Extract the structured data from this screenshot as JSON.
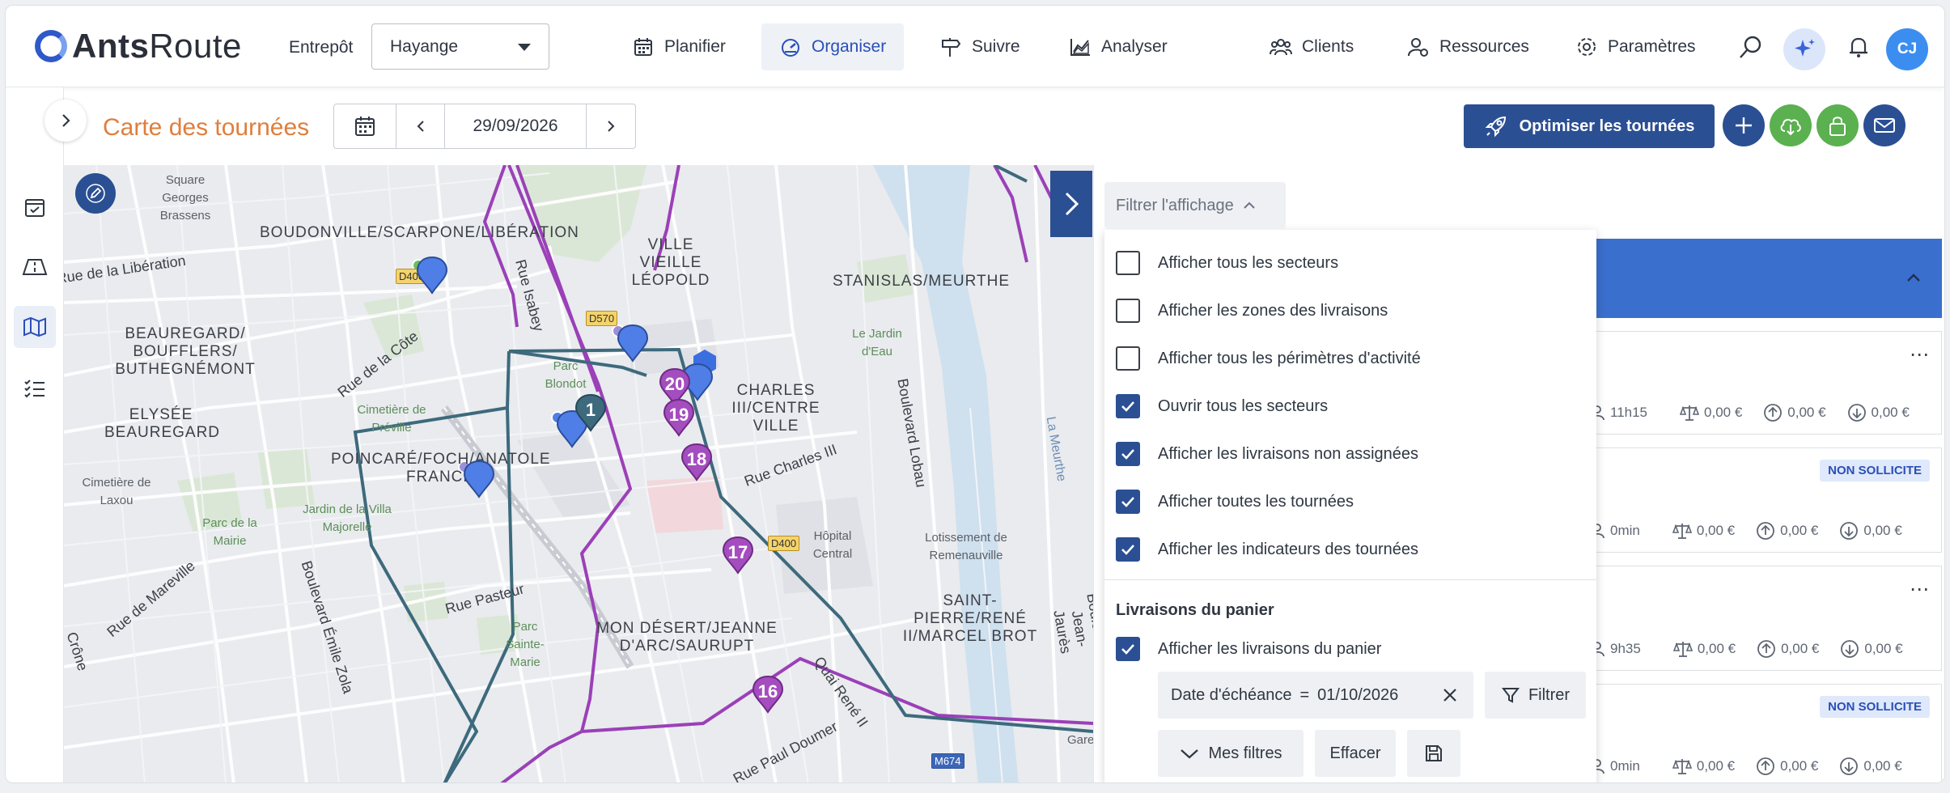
{
  "brand": {
    "name_bold": "Ants",
    "name_regular": "Route"
  },
  "warehouse": {
    "label": "Entrepôt",
    "value": "Hayange"
  },
  "nav": {
    "items": [
      {
        "label": "Planifier",
        "icon": "calendar-icon"
      },
      {
        "label": "Organiser",
        "icon": "dashboard-icon",
        "active": true
      },
      {
        "label": "Suivre",
        "icon": "signpost-icon"
      },
      {
        "label": "Analyser",
        "icon": "chart-icon"
      },
      {
        "label": "Clients",
        "icon": "users-icon"
      },
      {
        "label": "Ressources",
        "icon": "user-gear-icon"
      },
      {
        "label": "Paramètres",
        "icon": "gear-icon"
      }
    ],
    "avatar_initials": "CJ"
  },
  "page": {
    "title": "Carte des tournées",
    "date": "29/09/2026",
    "optimize_label": "Optimiser les tournées"
  },
  "map": {
    "districts": [
      "BOUDONVILLE/SCARPONE/LIBÉRATION",
      "VILLE VIEILLE LÉOPOLD",
      "STANISLAS/MEURTHE",
      "BEAUREGARD/ BOUFFLERS/ BUTHEGNÉMONT",
      "ELYSÉE BEAUREGARD",
      "CHARLES III/CENTRE VILLE",
      "POINCARÉ/FOCH/ANATOLE FRANCE",
      "MON DÉSERT/JEANNE D'ARC/SAURUPT",
      "SAINT-PIERRE/RENÉ II/MARCEL BROT"
    ],
    "places": [
      "Square Georges Brassens",
      "Parc Blondot",
      "Cimetière de Préville",
      "Cimetière de Laxou",
      "Parc de la Mairie",
      "Jardin de la Villa Majorelle",
      "Parc Sainte-Marie",
      "Hôpital Central",
      "Lotissement de Remenauville",
      "Le Jardin d'Eau",
      "La Meurthe",
      "Gare"
    ],
    "streets": [
      "Rue de la Libération",
      "Rue Isabey",
      "Rue de la Côte",
      "Boulevard Lobau",
      "Rue Charles III",
      "Rue de Mareville",
      "Boulevard Émile Zola",
      "Rue Pasteur",
      "Quai René II",
      "Rue Paul Doumer",
      "Crône",
      "Boulevard Jean-Jaurès"
    ],
    "road_badges": [
      "D400",
      "D570",
      "D400",
      "M674"
    ],
    "stops": [
      "20",
      "19",
      "18",
      "17",
      "16",
      "1"
    ]
  },
  "filter": {
    "toggle_label": "Filtrer l'affichage",
    "options": [
      {
        "label": "Afficher tous les secteurs",
        "checked": false
      },
      {
        "label": "Afficher les zones des livraisons",
        "checked": false
      },
      {
        "label": "Afficher tous les périmètres d'activité",
        "checked": false
      },
      {
        "label": "Ouvrir tous les secteurs",
        "checked": true
      },
      {
        "label": "Afficher les livraisons non assignées",
        "checked": true
      },
      {
        "label": "Afficher toutes les tournées",
        "checked": true
      },
      {
        "label": "Afficher les indicateurs des tournées",
        "checked": true
      }
    ],
    "basket_title": "Livraisons du panier",
    "basket_option": {
      "label": "Afficher les livraisons du panier",
      "checked": true
    },
    "chip": {
      "field": "Date d'échéance",
      "op": "=",
      "value": "01/10/2026"
    },
    "filter_button": "Filtrer",
    "my_filters": "Mes filtres",
    "clear": "Effacer"
  },
  "tours": [
    {
      "badge": "",
      "duration": "11h15",
      "weight": "0,00 €",
      "up": "0,00 €",
      "down": "0,00 €"
    },
    {
      "badge": "NON SOLLICITE",
      "duration": "0min",
      "weight": "0,00 €",
      "up": "0,00 €",
      "down": "0,00 €"
    },
    {
      "badge": "",
      "duration": "9h35",
      "weight": "0,00 €",
      "up": "0,00 €",
      "down": "0,00 €"
    },
    {
      "badge": "NON SOLLICITE",
      "duration": "0min",
      "weight": "0,00 €",
      "up": "0,00 €",
      "down": "0,00 €"
    }
  ],
  "colors": {
    "primary": "#2b4f93",
    "accent_orange": "#e07e3c",
    "route_teal": "#3d6a7c",
    "route_purple": "#9b40b8",
    "stop_purple": "#a44dbf",
    "pin_blue": "#4f7ee6",
    "green_btn": "#5bb04f"
  }
}
